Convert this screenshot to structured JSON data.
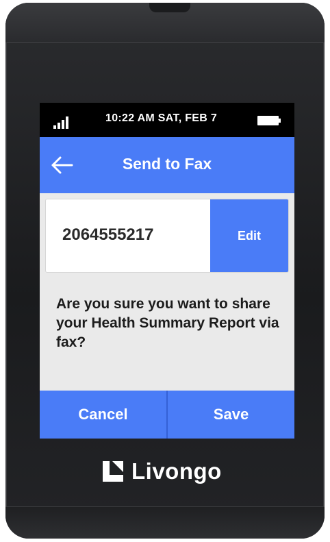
{
  "status_bar": {
    "time_date": "10:22 AM   SAT, FEB 7",
    "signal_icon": "signal-bars-icon",
    "battery_icon": "battery-full-icon"
  },
  "header": {
    "back_icon": "back-arrow-icon",
    "title": "Send to Fax"
  },
  "fax": {
    "number": "2064555217",
    "edit_label": "Edit"
  },
  "message": "Are you sure you want to share your Health Summary Report via fax?",
  "actions": {
    "cancel_label": "Cancel",
    "save_label": "Save"
  },
  "brand": {
    "name": "Livongo",
    "logo_icon": "livongo-logo-icon"
  },
  "colors": {
    "accent": "#4a7cf7",
    "screen_background": "#eaeaea",
    "status_bar": "#000000",
    "device_body": "#1f2022"
  }
}
